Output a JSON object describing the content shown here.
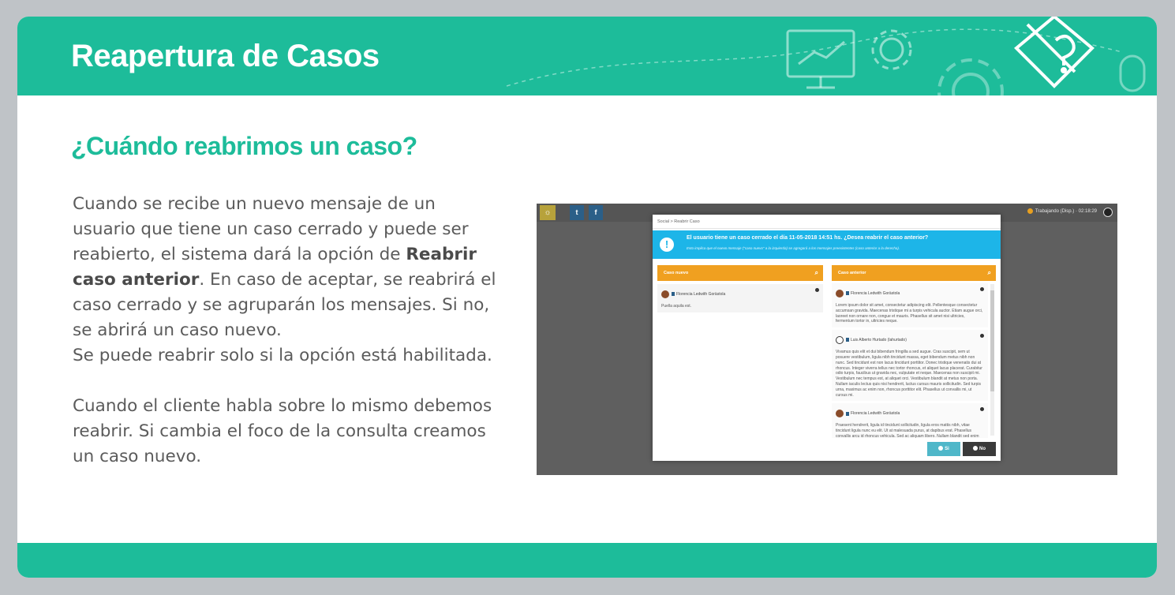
{
  "header": {
    "title": "Reapertura de Casos"
  },
  "question": "¿Cuándo reabrimos un caso?",
  "paragraph1": {
    "part1": "Cuando se recibe un nuevo mensaje de un usuario que tiene un caso cerrado y puede ser reabierto, el sistema dará la opción de ",
    "bold": "Reabrir caso anterior",
    "part2": ". En caso de aceptar, se reabrirá el caso cerrado y se agruparán los mensajes. Si no, se abrirá un caso nuevo."
  },
  "paragraph2": "Se puede reabrir solo si la opción está habilitada.",
  "paragraph3": "Cuando el cliente habla sobre lo mismo debemos reabrir. Si cambia el foco de la consulta creamos un caso nuevo.",
  "screenshot": {
    "status": "Trabajando (Disp.) · 02:18:29",
    "modal": {
      "breadcrumb": "Social > Reabrir Caso",
      "alert_title": "El usuario tiene un caso cerrado el día 11-05-2018 14:51 hs. ¿Desea reabrir el caso anterior?",
      "alert_sub": "Esto implica que el nuevo mensaje (\"caso nuevo\" a la izquierda) se agregará a los mensajes preexistentes (caso anterior a la derecha).",
      "left_panel": {
        "title": "Caso nuevo",
        "message": {
          "author": "Florencia Ledwith Gorästola",
          "text": "Puella aquila est."
        }
      },
      "right_panel": {
        "title": "Caso anterior",
        "messages": [
          {
            "author": "Florencia Ledwith Gorästola",
            "text": "Lorem ipsum dolor sit amet, consectetur adipiscing elit. Pellentesque consectetur accumsan gravida. Maecenas tristique mi a turpis vehicula auctor. Etiam augue orci, laoreet non ornare non, congue et mauris. Phasellus sit amet nisi ultricies, fermentum tortor in, ultricies neque."
          },
          {
            "author": "Luis Alberto Hurtado (lahurtado)",
            "text": "Vivamus quis elit et dui bibendum fringilla a sed augue. Cras suscipit, sem ut posuere vestibulum, ligula nibh tincidunt massa, eget bibendum metus nibh non nunc. Sed tincidunt est non lacus tincidunt porttitor. Donec tristique venenatis dui at rhoncus. Integer viverra tellus nec tortor rhoncus, et aliquet lacus placerat. Curabitur odio turpis, faucibus ut gravida nec, vulputate et neque. Maecenas non suscipit mi. Vestibulum nec tempus est, at aliquet orci. Vestibulum blandit at metus non porta. Nullam iaculis lectus quis nisi hendrerit, luctus cursus mauris sollicitudin. Sed turpis urna, maximus ac enim non, rhoncus porttitor elit. Phasellus ut convallis mi, ut cursus mi."
          },
          {
            "author": "Florencia Ledwith Gorästola",
            "text": "Praesent hendrerit, ligula id tincidunt sollicitudin, ligula eros mattis nibh, vitae tincidunt ligula nunc eu elit. Ut at malesuada purus, at dapibus erat. Phasellus convallis arcu id rhoncus vehicula. Sed ac aliquam libero. Nullam blandit sed enim quis sodales."
          }
        ]
      },
      "yes_label": "Si",
      "no_label": "No"
    }
  },
  "colors": {
    "brand": "#1dbc9a",
    "alert": "#1db5e8",
    "panel_header": "#f0a020"
  }
}
